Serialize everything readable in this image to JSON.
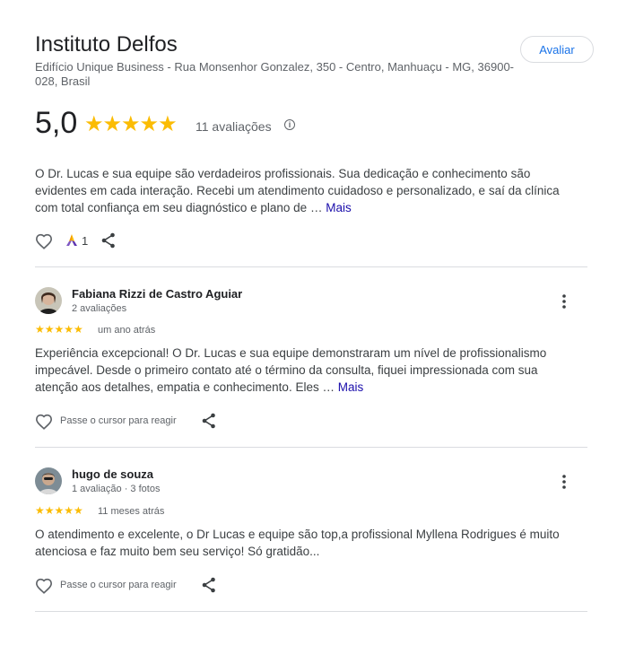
{
  "header": {
    "title": "Instituto Delfos",
    "address": "Edifício Unique Business - Rua Monsenhor Gonzalez, 350 - Centro, Manhuaçu - MG, 36900-028, Brasil",
    "rate_button": "Avaliar"
  },
  "summary": {
    "score": "5,0",
    "stars": "★★★★★",
    "count": "11 avaliações",
    "info": "i"
  },
  "featured": {
    "text": "O Dr. Lucas e sua equipe são verdadeiros profissionais. Sua dedicação e conhecimento são evidentes em cada interação. Recebi um atendimento cuidadoso e personalizado, e saí da clínica com total confiança em seu diagnóstico e plano de …",
    "more": "Mais",
    "reaction_count": "1"
  },
  "reviews": [
    {
      "name": "Fabiana Rizzi de Castro Aguiar",
      "meta": "2 avaliações",
      "stars": "★★★★★",
      "rating": 5,
      "time": "um ano atrás",
      "text": "Experiência excepcional! O Dr. Lucas e sua equipe demonstraram um nível de profissionalismo impecável. Desde o primeiro contato até o término da consulta, fiquei impressionada com sua atenção aos detalhes, empatia e conhecimento. Eles …",
      "more": "Mais",
      "react_label": "Passe o cursor para reagir"
    },
    {
      "name": "hugo de souza",
      "meta": "1 avaliação · 3 fotos",
      "stars": "★★★★★",
      "rating": 5,
      "time": "11 meses atrás",
      "text": "O atendimento e excelente, o Dr Lucas e equipe são top,a profissional Myllena Rodrigues é muito atenciosa e faz muito bem seu serviço! Só gratidão...",
      "react_label": "Passe o cursor para reagir"
    }
  ],
  "colors": {
    "star": "#fbbc04",
    "link": "#1a0dab",
    "button_text": "#1a73e8",
    "divider": "#dadce0"
  }
}
